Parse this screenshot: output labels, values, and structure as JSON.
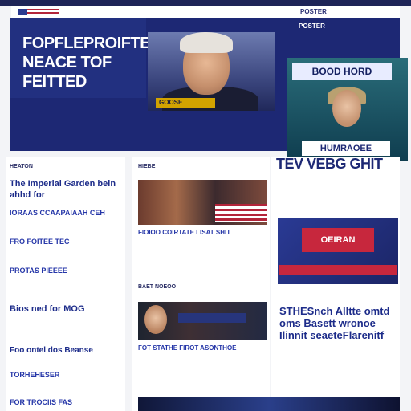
{
  "masthead": {
    "nav_left": "",
    "nav_mid": "",
    "nav_right": "POSTER"
  },
  "hero": {
    "headline_lines": [
      "FOPFLEPROIFTE",
      "NEACE TOF",
      "FEITTED"
    ],
    "photo_caption": "GOOSE",
    "body": "",
    "right_label": "POSTER",
    "right_sub": "",
    "promo_top": "BOOD HORD",
    "promo_bottom": "HUMRAOEE"
  },
  "left_column": {
    "section_label": "HEATON",
    "stories": [
      {
        "title": "The Imperial Garden bein ahhd for",
        "type": "headline"
      },
      {
        "title": "IORAAS CCAAPAIAAH CEH",
        "type": "link"
      },
      {
        "title": "FRO FOITEE TEC",
        "type": "link"
      },
      {
        "title": "PROTAS PIEEEE",
        "type": "link"
      },
      {
        "title": "Bios ned for MOG",
        "type": "headline"
      },
      {
        "title": "Foo ontel dos Beanse",
        "type": "headline"
      },
      {
        "title": "TORHEHESER",
        "type": "link"
      },
      {
        "title": "FOR TROCIIS FAS",
        "type": "link"
      }
    ]
  },
  "mid_column": {
    "section_label": "HIEBE",
    "story_1": "FIOIOO COIRTATE LISAT SHIT",
    "section_label_2": "BAET NOEOO",
    "story_2": "FOT STATHE FIROT ASONTHOE",
    "thumb_2_tag": ""
  },
  "right_column": {
    "headline": "TEV VEBG GHIT",
    "ad_badge": "OEIRAN",
    "ad_bar": "",
    "story": "STHESnch Alltte omtd oms Basett wronoe Ilinnit seaeteFlarenitf"
  }
}
